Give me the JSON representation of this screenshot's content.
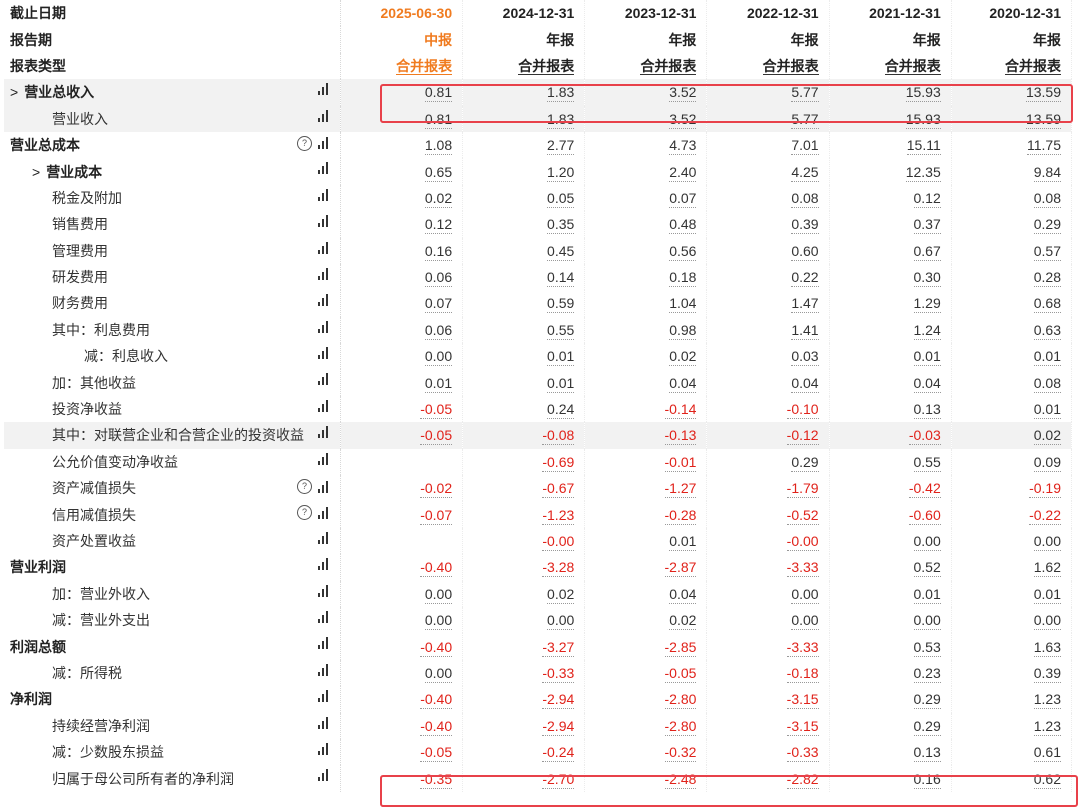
{
  "headers": {
    "row1_label": "截止日期",
    "row2_label": "报告期",
    "row3_label": "报表类型",
    "dates": [
      "2025-06-30",
      "2024-12-31",
      "2023-12-31",
      "2022-12-31",
      "2021-12-31",
      "2020-12-31"
    ],
    "periods": [
      "中报",
      "年报",
      "年报",
      "年报",
      "年报",
      "年报"
    ],
    "types": [
      "合并报表",
      "合并报表",
      "合并报表",
      "合并报表",
      "合并报表",
      "合并报表"
    ]
  },
  "accent_color": "#f07b1f",
  "negative_color": "#e0221a",
  "highlight_color": "#e8414a",
  "rows": [
    {
      "label": "营业总收入",
      "expand": ">",
      "values": [
        "0.81",
        "1.83",
        "3.52",
        "5.77",
        "15.93",
        "13.59"
      ]
    },
    {
      "label": "营业收入",
      "values": [
        "0.81",
        "1.83",
        "3.52",
        "5.77",
        "15.93",
        "13.59"
      ]
    },
    {
      "label": "营业总成本",
      "values": [
        "1.08",
        "2.77",
        "4.73",
        "7.01",
        "15.11",
        "11.75"
      ]
    },
    {
      "label": "营业成本",
      "expand": ">",
      "values": [
        "0.65",
        "1.20",
        "2.40",
        "4.25",
        "12.35",
        "9.84"
      ]
    },
    {
      "label": "税金及附加",
      "values": [
        "0.02",
        "0.05",
        "0.07",
        "0.08",
        "0.12",
        "0.08"
      ]
    },
    {
      "label": "销售费用",
      "values": [
        "0.12",
        "0.35",
        "0.48",
        "0.39",
        "0.37",
        "0.29"
      ]
    },
    {
      "label": "管理费用",
      "values": [
        "0.16",
        "0.45",
        "0.56",
        "0.60",
        "0.67",
        "0.57"
      ]
    },
    {
      "label": "研发费用",
      "values": [
        "0.06",
        "0.14",
        "0.18",
        "0.22",
        "0.30",
        "0.28"
      ]
    },
    {
      "label": "财务费用",
      "values": [
        "0.07",
        "0.59",
        "1.04",
        "1.47",
        "1.29",
        "0.68"
      ]
    },
    {
      "label": "其中：利息费用",
      "values": [
        "0.06",
        "0.55",
        "0.98",
        "1.41",
        "1.24",
        "0.63"
      ]
    },
    {
      "label": "减：利息收入",
      "values": [
        "0.00",
        "0.01",
        "0.02",
        "0.03",
        "0.01",
        "0.01"
      ]
    },
    {
      "label": "加：其他收益",
      "values": [
        "0.01",
        "0.01",
        "0.04",
        "0.04",
        "0.04",
        "0.08"
      ]
    },
    {
      "label": "投资净收益",
      "values": [
        "-0.05",
        "0.24",
        "-0.14",
        "-0.10",
        "0.13",
        "0.01"
      ]
    },
    {
      "label": "其中：对联营企业和合营企业的投资收益",
      "values": [
        "-0.05",
        "-0.08",
        "-0.13",
        "-0.12",
        "-0.03",
        "0.02"
      ]
    },
    {
      "label": "公允价值变动净收益",
      "values": [
        "",
        "-0.69",
        "-0.01",
        "0.29",
        "0.55",
        "0.09"
      ]
    },
    {
      "label": "资产减值损失",
      "values": [
        "-0.02",
        "-0.67",
        "-1.27",
        "-1.79",
        "-0.42",
        "-0.19"
      ]
    },
    {
      "label": "信用减值损失",
      "values": [
        "-0.07",
        "-1.23",
        "-0.28",
        "-0.52",
        "-0.60",
        "-0.22"
      ]
    },
    {
      "label": "资产处置收益",
      "values": [
        "",
        "-0.00",
        "0.01",
        "-0.00",
        "0.00",
        "0.00"
      ]
    },
    {
      "label": "营业利润",
      "values": [
        "-0.40",
        "-3.28",
        "-2.87",
        "-3.33",
        "0.52",
        "1.62"
      ]
    },
    {
      "label": "加：营业外收入",
      "values": [
        "0.00",
        "0.02",
        "0.04",
        "0.00",
        "0.01",
        "0.01"
      ]
    },
    {
      "label": "减：营业外支出",
      "values": [
        "0.00",
        "0.00",
        "0.02",
        "0.00",
        "0.00",
        "0.00"
      ]
    },
    {
      "label": "利润总额",
      "values": [
        "-0.40",
        "-3.27",
        "-2.85",
        "-3.33",
        "0.53",
        "1.63"
      ]
    },
    {
      "label": "减：所得税",
      "values": [
        "0.00",
        "-0.33",
        "-0.05",
        "-0.18",
        "0.23",
        "0.39"
      ]
    },
    {
      "label": "净利润",
      "values": [
        "-0.40",
        "-2.94",
        "-2.80",
        "-3.15",
        "0.29",
        "1.23"
      ]
    },
    {
      "label": "持续经营净利润",
      "values": [
        "-0.40",
        "-2.94",
        "-2.80",
        "-3.15",
        "0.29",
        "1.23"
      ]
    },
    {
      "label": "减：少数股东损益",
      "values": [
        "-0.05",
        "-0.24",
        "-0.32",
        "-0.33",
        "0.13",
        "0.61"
      ]
    },
    {
      "label": "归属于母公司所有者的净利润",
      "values": [
        "-0.35",
        "-2.70",
        "-2.48",
        "-2.82",
        "0.16",
        "0.62"
      ]
    }
  ]
}
